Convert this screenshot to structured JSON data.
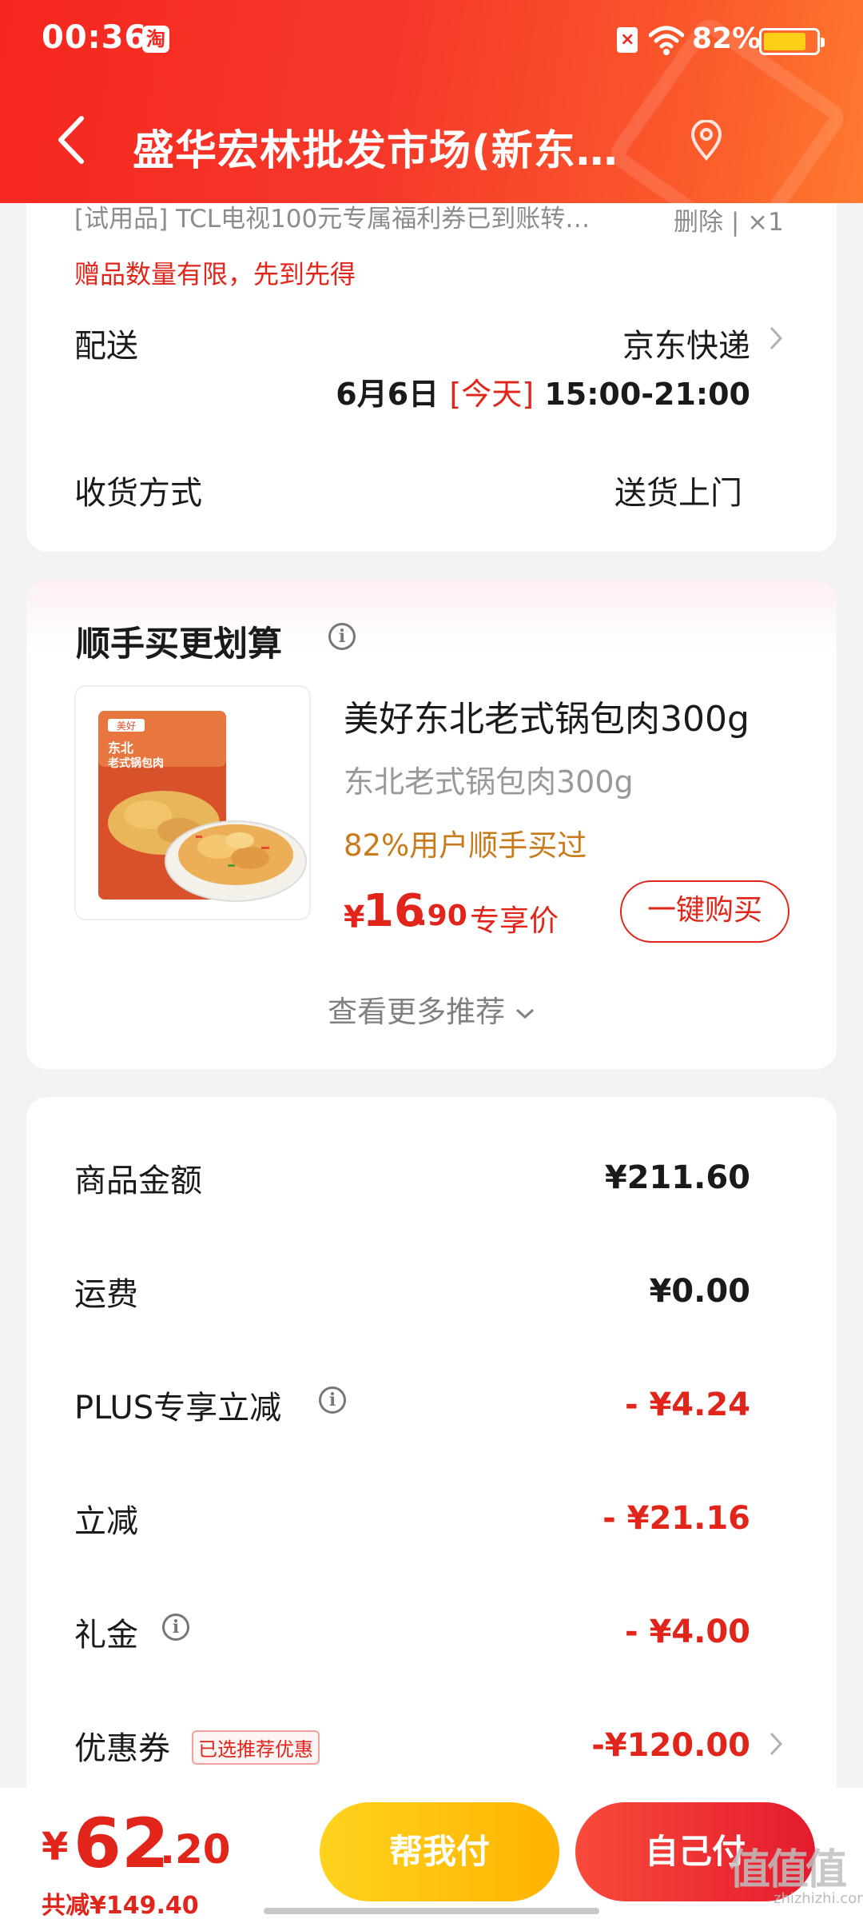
{
  "status_bar": {
    "time": "00:36",
    "app_badge": "淘",
    "battery": "82%",
    "battery_level": 0.82
  },
  "nav": {
    "title": "盛华宏林批发市场(新东…"
  },
  "gift": {
    "line": "[试用品]  TCL电视100元专属福利券已到账转…",
    "delete": "删除 | ×1",
    "note": "赠品数量有限，先到先得"
  },
  "delivery": {
    "label": "配送",
    "carrier": "京东快递",
    "date": "6月6日",
    "today": "[今天]",
    "time_range": "15:00-21:00",
    "method_label": "收货方式",
    "method_value": "送货上门"
  },
  "bundle": {
    "title": "顺手买更划算",
    "product_name": "美好东北老式锅包肉300g",
    "product_sub": "东北老式锅包肉300g",
    "product_tag": "82%用户顺手买过",
    "price_symbol": "¥",
    "price_int": "16",
    "price_dec": ".90",
    "price_label": "专享价",
    "buy_button": "一键购买",
    "more": "查看更多推荐",
    "package": {
      "brand": "美好",
      "name_line1": "东北",
      "name_line2": "老式锅包肉"
    }
  },
  "summary": {
    "rows": [
      {
        "label": "商品金额",
        "value": "¥211.60"
      },
      {
        "label": "运费",
        "value": "¥0.00"
      },
      {
        "label": "PLUS专享立减",
        "value": "- ¥4.24"
      },
      {
        "label": "立减",
        "value": "- ¥21.16"
      },
      {
        "label": "礼金",
        "value": "- ¥4.00"
      },
      {
        "label": "优惠券",
        "tag": "已选推荐优惠",
        "value": "-¥120.00"
      }
    ]
  },
  "bottom": {
    "total_symbol": "¥",
    "total_int": "62",
    "total_dec": ".20",
    "total_saved": "共减¥149.40",
    "help_pay": "帮我付",
    "self_pay": "自己付",
    "watermark": "值值值",
    "watermark_sub": "zhizhizhi.com"
  },
  "colors": {
    "brand_red": "#e1251b",
    "header_start": "#f5261f",
    "header_end": "#ff7a2f",
    "help_yellow": "#ffc20e",
    "self_red": "#f0302f"
  }
}
